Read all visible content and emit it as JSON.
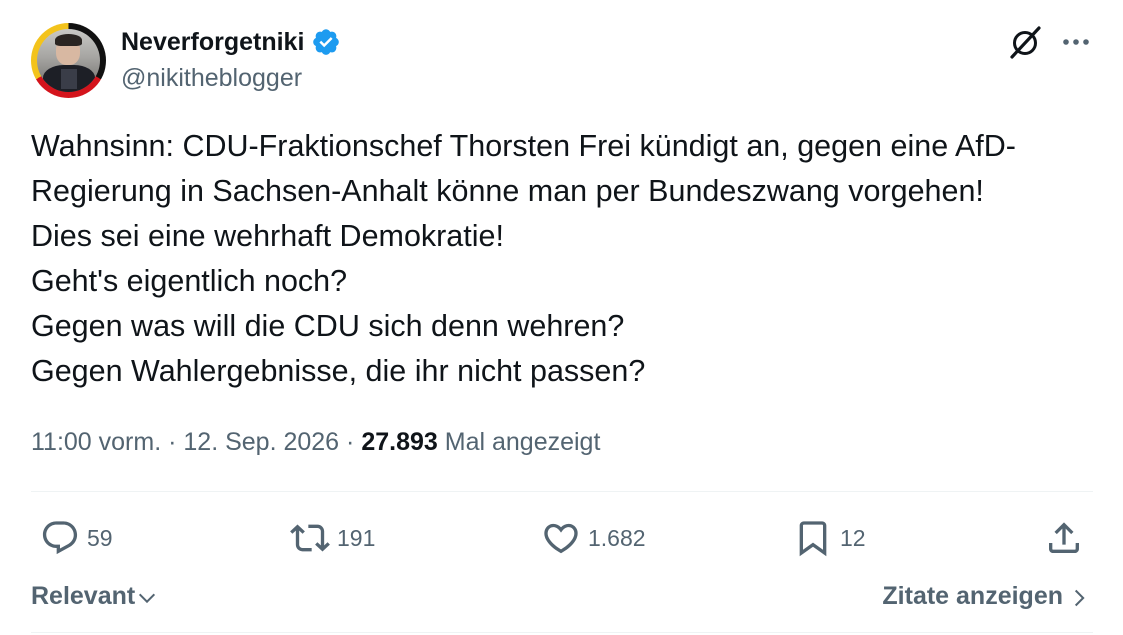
{
  "author": {
    "display_name": "Neverforgetniki",
    "handle": "@nikitheblogger",
    "verified": true,
    "avatar_ring_colors": [
      "#111111",
      "#d4141c",
      "#f3c31c"
    ]
  },
  "tweet": {
    "lines": [
      "Wahnsinn: CDU-Fraktionschef Thorsten Frei kündigt an, gegen eine AfD-",
      "Regierung in Sachsen-Anhalt könne man per Bundeszwang vorgehen!",
      "Dies sei eine wehrhaft Demokratie!",
      "Geht's eigentlich noch?",
      "Gegen was will die CDU sich denn wehren?",
      "Gegen Wahlergebnisse, die ihr nicht passen?"
    ]
  },
  "meta": {
    "time": "11:00 vorm.",
    "separator": "·",
    "date": "12. Sep. 2026",
    "views_count": "27.893",
    "views_label": "Mal angezeigt"
  },
  "actions": {
    "replies": "59",
    "reposts": "191",
    "likes": "1.682",
    "bookmarks": "12"
  },
  "footer": {
    "sort_label": "Relevant",
    "quotes_label": "Zitate anzeigen"
  },
  "icons": [
    "verified-badge-icon",
    "grok-icon",
    "more-icon",
    "reply-icon",
    "repost-icon",
    "like-icon",
    "bookmark-icon",
    "share-icon",
    "chevron-down-icon",
    "chevron-right-icon"
  ],
  "colors": {
    "text_primary": "#0f1419",
    "text_secondary": "#536471",
    "verified_blue": "#1d9bf0",
    "divider": "#eff3f4"
  }
}
